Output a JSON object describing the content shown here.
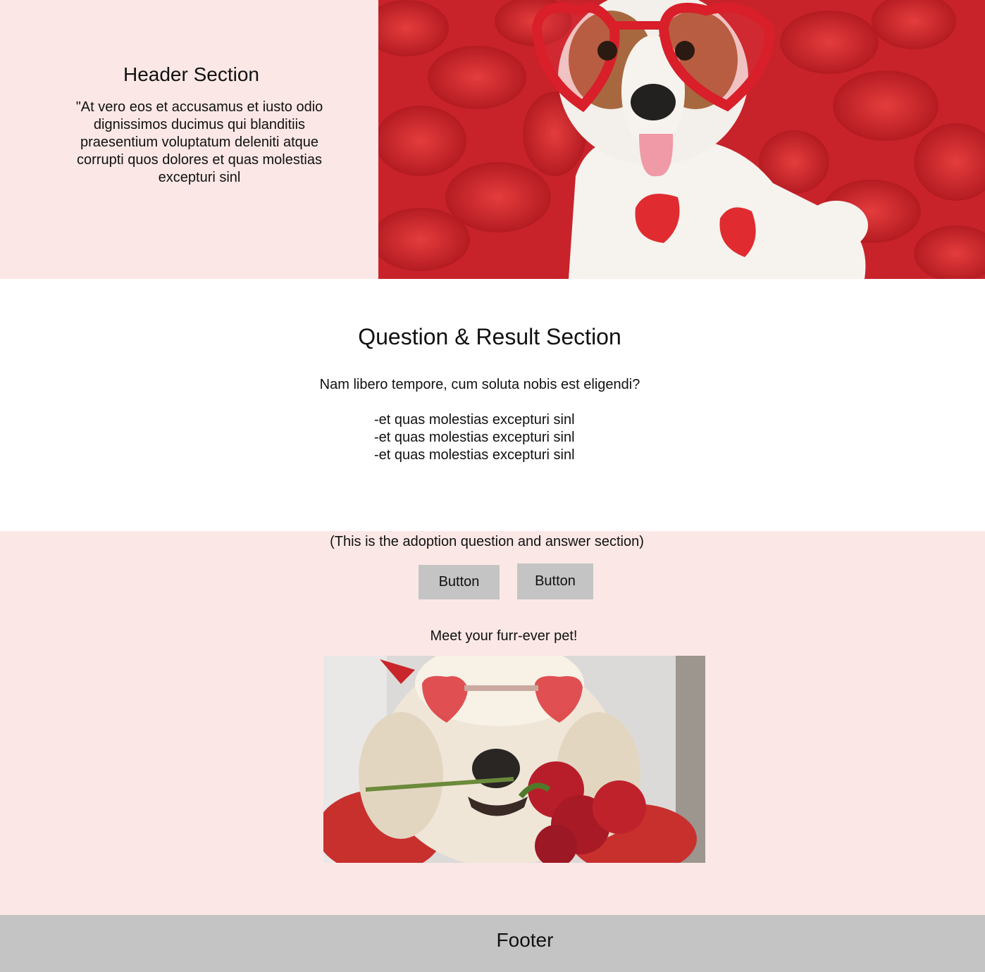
{
  "header": {
    "title": "Header Section",
    "body": "\"At vero eos et accusamus et iusto odio dignissimos ducimus qui blanditiis praesentium voluptatum deleniti atque corrupti quos dolores et quas molestias excepturi sinl"
  },
  "question_section": {
    "title": "Question & Result Section",
    "question": "Nam libero tempore, cum soluta nobis est eligendi?",
    "answers": [
      "-et quas molestias excepturi sinl",
      "-et quas molestias excepturi sinl",
      "-et quas molestias excepturi sinl"
    ]
  },
  "adoption": {
    "note": "(This is the adoption question and answer section)",
    "buttons": [
      "Button",
      "Button"
    ],
    "meet_text": "Meet your furr-ever pet!"
  },
  "footer": {
    "text": "Footer"
  },
  "colors": {
    "section_pink": "#fbe8e6",
    "button_grey": "#c4c4c4",
    "footer_grey": "#c4c4c4"
  }
}
